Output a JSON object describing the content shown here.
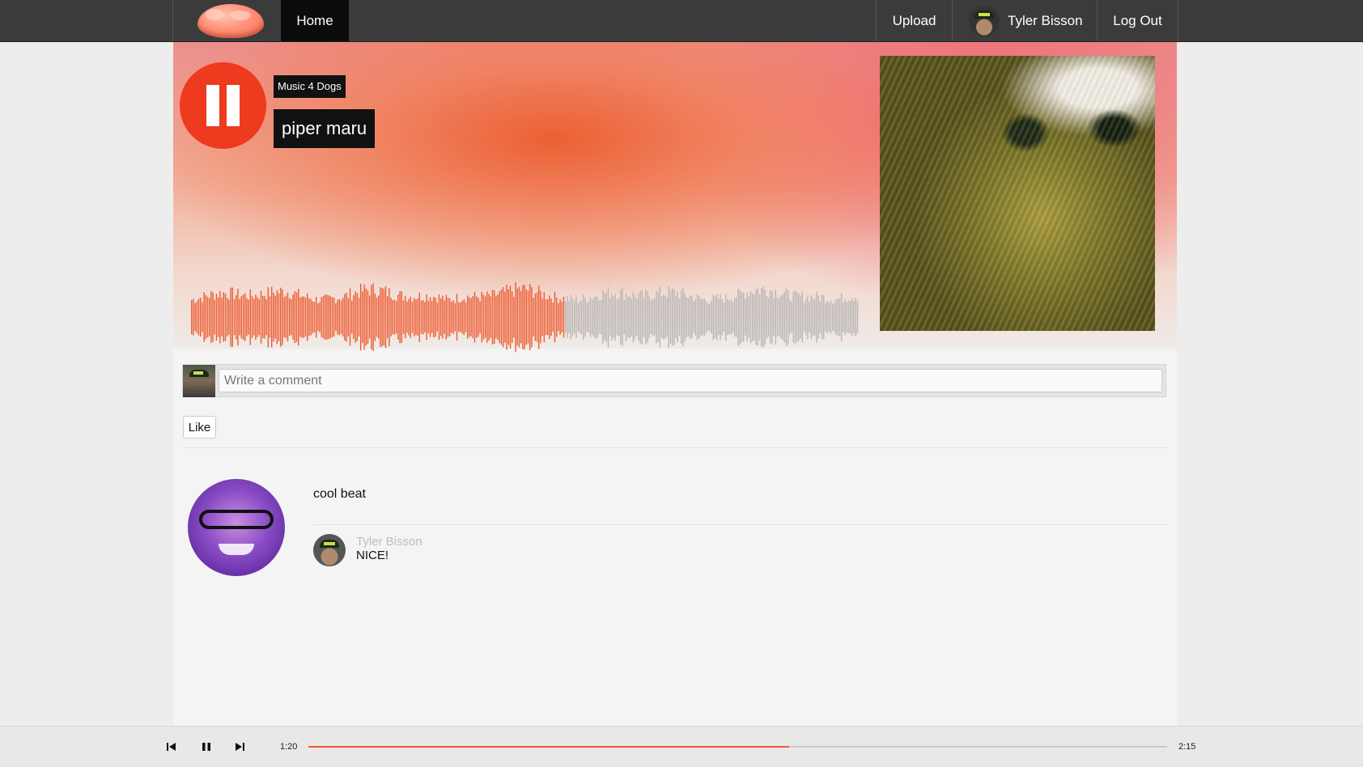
{
  "nav": {
    "home": "Home",
    "upload": "Upload",
    "user_name": "Tyler Bisson",
    "logout": "Log Out"
  },
  "track": {
    "artist": "Music 4 Dogs",
    "title": "piper maru",
    "state": "playing",
    "played_fraction": 0.56
  },
  "comment_form": {
    "placeholder": "Write a comment"
  },
  "like_label": "Like",
  "comments": [
    {
      "text": "cool beat",
      "replies": [
        {
          "author": "Tyler Bisson",
          "text": "NICE!"
        }
      ]
    }
  ],
  "player": {
    "current_time": "1:20",
    "duration": "2:15",
    "progress_fraction": 0.56
  },
  "colors": {
    "accent": "#ee3a1e",
    "waveform_played": "#ee5a2f",
    "waveform_unplayed": "#b9b6b4",
    "nav_bg": "#3b3b3b"
  },
  "icons": {
    "prev": "skip-back-icon",
    "pause": "pause-icon",
    "next": "skip-forward-icon"
  }
}
